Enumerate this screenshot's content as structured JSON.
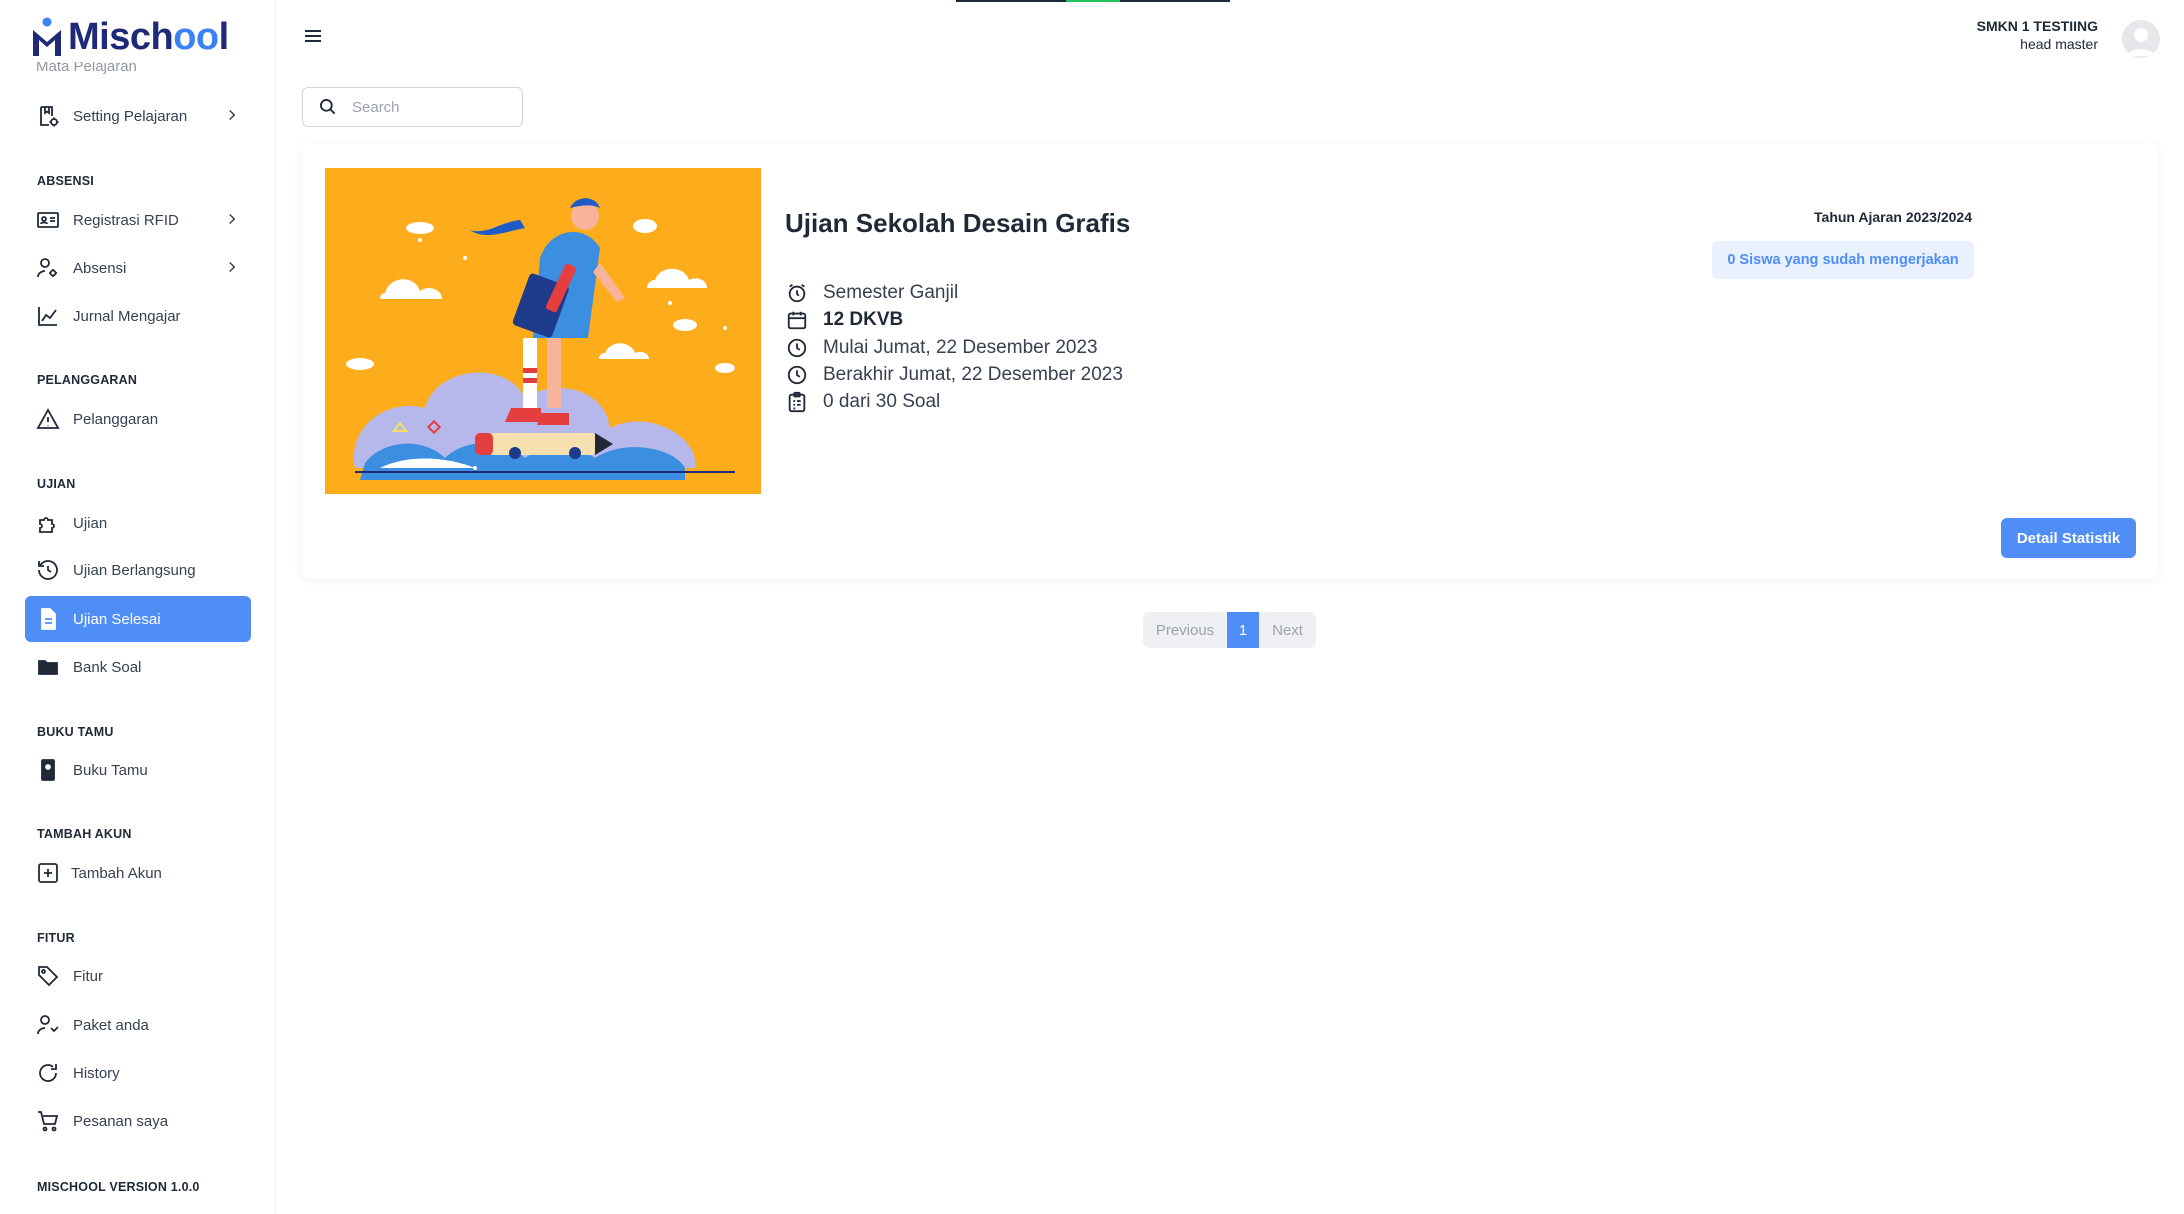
{
  "app": {
    "logo_text_start": "Misch",
    "logo_text_oo": "oo",
    "logo_text_end": "l"
  },
  "sidebar": {
    "cutoff_item": "Mata Pelajaran",
    "items": {
      "setting_pelajaran": "Setting Pelajaran",
      "registrasi_rfid": "Registrasi RFID",
      "absensi": "Absensi",
      "jurnal_mengajar": "Jurnal Mengajar",
      "pelanggaran": "Pelanggaran",
      "ujian": "Ujian",
      "ujian_berlangsung": "Ujian Berlangsung",
      "ujian_selesai": "Ujian Selesai",
      "bank_soal": "Bank Soal",
      "buku_tamu": "Buku Tamu",
      "tambah_akun": "Tambah Akun",
      "fitur": "Fitur",
      "paket_anda": "Paket anda",
      "history": "History",
      "pesanan_saya": "Pesanan saya"
    },
    "sections": {
      "absensi": "ABSENSI",
      "pelanggaran": "PELANGGARAN",
      "ujian": "UJIAN",
      "buku_tamu": "BUKU TAMU",
      "tambah_akun": "TAMBAH AKUN",
      "fitur": "FITUR",
      "version": "MISCHOOL VERSION 1.0.0"
    },
    "active_item": "ujian_selesai"
  },
  "header": {
    "school": "SMKN 1 TESTIING",
    "role": "head master"
  },
  "search": {
    "placeholder": "Search",
    "value": ""
  },
  "exam": {
    "title": "Ujian Sekolah Desain Grafis",
    "semester": "Semester Ganjil",
    "class": "12 DKVB",
    "start": "Mulai Jumat, 22 Desember 2023",
    "end": "Berakhir Jumat, 22 Desember 2023",
    "questions": "0 dari 30 Soal",
    "year": "Tahun Ajaran 2023/2024",
    "students_badge": "0 Siswa yang sudah mengerjakan",
    "detail_button": "Detail Statistik"
  },
  "pagination": {
    "previous": "Previous",
    "current": "1",
    "next": "Next"
  },
  "colors": {
    "accent": "#4f8ef7",
    "brand_dark": "#1e2a78",
    "illustration_bg": "#fdac1c",
    "badge_bg": "#e8f1fd"
  },
  "icons": {
    "setting_pelajaran": "book-gear-icon",
    "registrasi_rfid": "id-card-icon",
    "absensi": "user-gear-icon",
    "jurnal_mengajar": "chart-icon",
    "pelanggaran": "warning-icon",
    "ujian": "puzzle-icon",
    "ujian_berlangsung": "history-icon",
    "ujian_selesai": "document-icon",
    "bank_soal": "folder-icon",
    "buku_tamu": "guestbook-icon",
    "tambah_akun": "plus-square-icon",
    "fitur": "tag-icon",
    "paket_anda": "user-package-icon",
    "history": "refresh-icon",
    "pesanan_saya": "cart-icon"
  }
}
